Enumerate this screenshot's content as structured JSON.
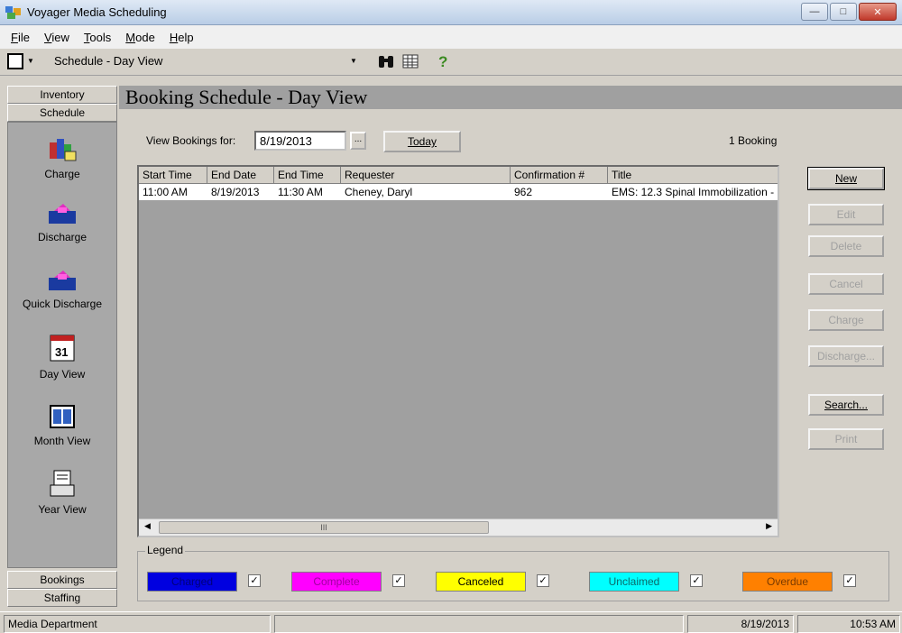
{
  "window": {
    "title": "Voyager Media Scheduling"
  },
  "menu": [
    {
      "pre": "",
      "ul": "F",
      "post": "ile"
    },
    {
      "pre": "",
      "ul": "V",
      "post": "iew"
    },
    {
      "pre": "",
      "ul": "T",
      "post": "ools"
    },
    {
      "pre": "",
      "ul": "M",
      "post": "ode"
    },
    {
      "pre": "",
      "ul": "H",
      "post": "elp"
    }
  ],
  "toolbar": {
    "view_selector": "Schedule - Day View"
  },
  "nav": {
    "top_tabs": [
      "Inventory",
      "Schedule"
    ],
    "items": [
      "Charge",
      "Discharge",
      "Quick Discharge",
      "Day View",
      "Month View",
      "Year View"
    ],
    "bottom_tabs": [
      "Bookings",
      "Staffing"
    ]
  },
  "main": {
    "title": "Booking Schedule - Day View",
    "view_for_label": "View Bookings for:",
    "date_value": "8/19/2013",
    "ellipsis": "...",
    "today_label": "Today",
    "booking_count": "1 Booking"
  },
  "grid": {
    "columns": [
      "Start Time",
      "End Date",
      "End Time",
      "Requester",
      "Confirmation #",
      "Title"
    ],
    "rows": [
      [
        "11:00 AM",
        "8/19/2013",
        "11:30 AM",
        "Cheney, Daryl",
        "962",
        "EMS: 12.3 Spinal Immobilization -"
      ]
    ],
    "scroll_thumb": "III"
  },
  "actions": {
    "new": "New",
    "edit": "Edit",
    "delete": "Delete",
    "cancel": "Cancel",
    "charge": "Charge",
    "discharge": "Discharge...",
    "search": "Search...",
    "print": "Print"
  },
  "legend": {
    "title": "Legend",
    "items": [
      {
        "label": "Charged",
        "color": "#0000e0",
        "text_color": "#00007a"
      },
      {
        "label": "Complete",
        "color": "#ff00ff",
        "text_color": "#a000a0"
      },
      {
        "label": "Canceled",
        "color": "#ffff00",
        "text_color": "#000000"
      },
      {
        "label": "Unclaimed",
        "color": "#00ffff",
        "text_color": "#0a6a6a"
      },
      {
        "label": "Overdue",
        "color": "#ff8000",
        "text_color": "#7a3a00"
      }
    ]
  },
  "status": {
    "department": "Media Department",
    "date": "8/19/2013",
    "time": "10:53 AM"
  }
}
